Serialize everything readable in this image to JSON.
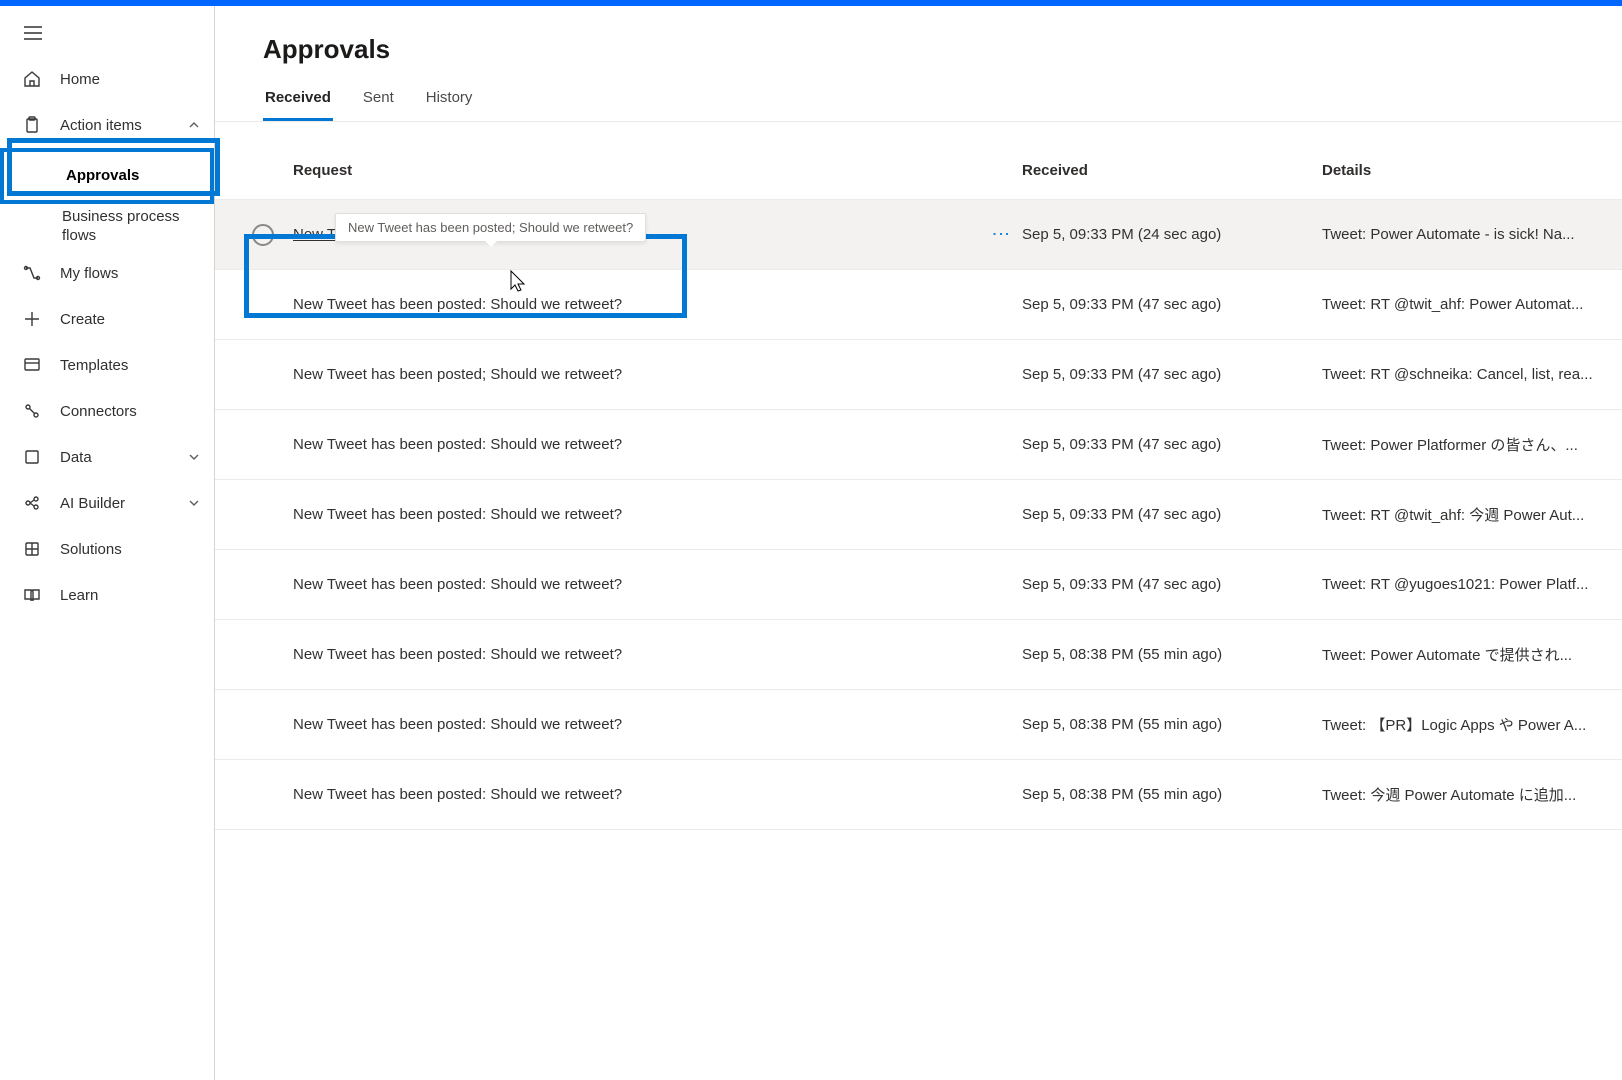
{
  "colors": {
    "accent": "#0078d4"
  },
  "sidebar": {
    "items": [
      {
        "id": "home",
        "label": "Home",
        "icon": "home-icon"
      },
      {
        "id": "action-items",
        "label": "Action items",
        "icon": "clipboard-icon",
        "expandable": true,
        "expanded": true
      },
      {
        "id": "approvals",
        "label": "Approvals",
        "sub": true,
        "active": true
      },
      {
        "id": "bpf",
        "label": "Business process flows",
        "sub": true
      },
      {
        "id": "my-flows",
        "label": "My flows",
        "icon": "flow-icon"
      },
      {
        "id": "create",
        "label": "Create",
        "icon": "plus-icon"
      },
      {
        "id": "templates",
        "label": "Templates",
        "icon": "templates-icon"
      },
      {
        "id": "connectors",
        "label": "Connectors",
        "icon": "connectors-icon"
      },
      {
        "id": "data",
        "label": "Data",
        "icon": "data-icon",
        "expandable": true
      },
      {
        "id": "ai-builder",
        "label": "AI Builder",
        "icon": "ai-icon",
        "expandable": true
      },
      {
        "id": "solutions",
        "label": "Solutions",
        "icon": "solutions-icon"
      },
      {
        "id": "learn",
        "label": "Learn",
        "icon": "learn-icon"
      }
    ]
  },
  "page": {
    "title": "Approvals",
    "tabs": [
      {
        "id": "received",
        "label": "Received",
        "active": true
      },
      {
        "id": "sent",
        "label": "Sent"
      },
      {
        "id": "history",
        "label": "History"
      }
    ],
    "columns": {
      "request": "Request",
      "received": "Received",
      "details": "Details"
    },
    "tooltip": "New Tweet has been posted; Should we retweet?",
    "rows": [
      {
        "request": "New Tweet has been posted: Should we retweet?",
        "received": "Sep 5, 09:33 PM (24 sec ago)",
        "details": "Tweet: Power Automate - is sick! Na...",
        "hovered": true
      },
      {
        "request": "New Tweet has been posted: Should we retweet?",
        "received": "Sep 5, 09:33 PM (47 sec ago)",
        "details": "Tweet: RT @twit_ahf: Power Automat..."
      },
      {
        "request": "New Tweet has been posted; Should we retweet?",
        "received": "Sep 5, 09:33 PM (47 sec ago)",
        "details": "Tweet: RT @schneika: Cancel, list, rea..."
      },
      {
        "request": "New Tweet has been posted: Should we retweet?",
        "received": "Sep 5, 09:33 PM (47 sec ago)",
        "details": "Tweet: Power Platformer の皆さん、..."
      },
      {
        "request": "New Tweet has been posted: Should we retweet?",
        "received": "Sep 5, 09:33 PM (47 sec ago)",
        "details": "Tweet: RT @twit_ahf: 今週 Power Aut..."
      },
      {
        "request": "New Tweet has been posted: Should we retweet?",
        "received": "Sep 5, 09:33 PM (47 sec ago)",
        "details": "Tweet: RT @yugoes1021: Power Platf..."
      },
      {
        "request": "New Tweet has been posted: Should we retweet?",
        "received": "Sep 5, 08:38 PM (55 min ago)",
        "details": "Tweet: Power Automate で提供され..."
      },
      {
        "request": "New Tweet has been posted: Should we retweet?",
        "received": "Sep 5, 08:38 PM (55 min ago)",
        "details": "Tweet: 【PR】Logic Apps や Power A..."
      },
      {
        "request": "New Tweet has been posted: Should we retweet?",
        "received": "Sep 5, 08:38 PM (55 min ago)",
        "details": "Tweet: 今週 Power Automate に追加..."
      }
    ]
  }
}
